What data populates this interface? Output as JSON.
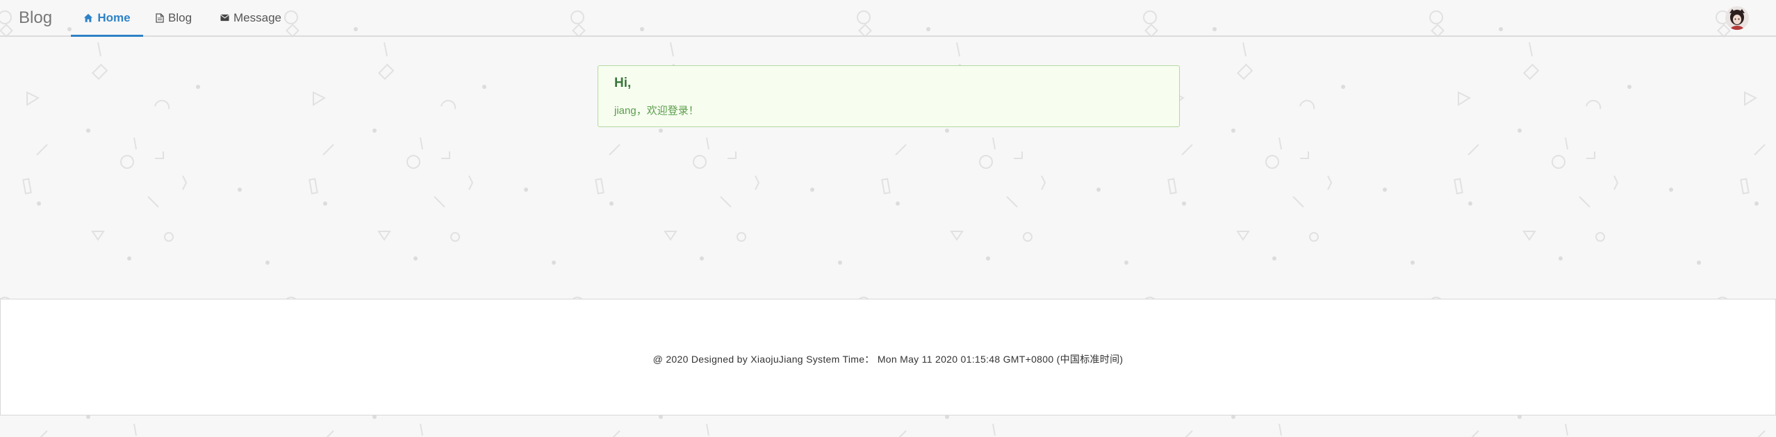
{
  "navbar": {
    "brand": "Blog",
    "items": [
      {
        "label": "Home",
        "icon": "home-icon",
        "active": true
      },
      {
        "label": "Blog",
        "icon": "file-icon",
        "active": false
      },
      {
        "label": "Message",
        "icon": "envelope-icon",
        "active": false
      }
    ],
    "avatar_icon": "user-avatar"
  },
  "alert": {
    "title": "Hi,",
    "message": "jiang，欢迎登录！"
  },
  "footer": {
    "copyright": "@ 2020 Designed by XiaojuJiang",
    "system_time_label": "System Time：",
    "system_time_value": "Mon May 11 2020 01:15:48 GMT+0800 (中国标准时间)"
  },
  "colors": {
    "accent": "#2e82c7",
    "alert_bg": "#f7fef0",
    "alert_border": "#b4d8a0",
    "alert_title": "#3c763d",
    "alert_text": "#5b9c4a",
    "page_bg": "#f7f7f7"
  }
}
